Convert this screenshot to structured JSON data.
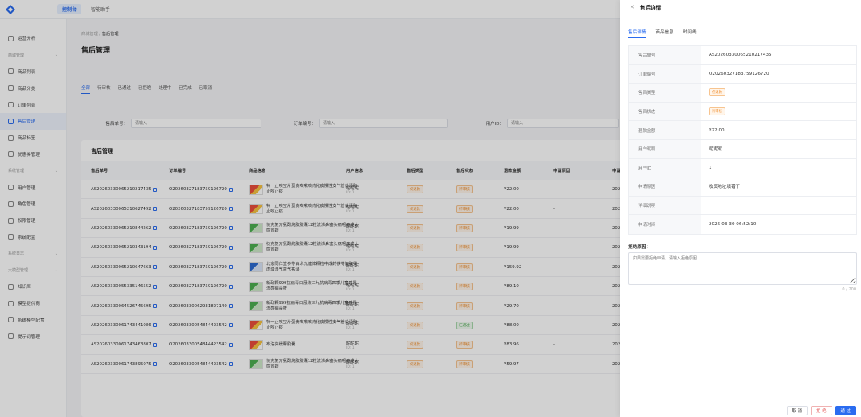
{
  "topbar": {
    "tabs": [
      "控制台",
      "智能助手"
    ]
  },
  "sidebar": {
    "items": [
      {
        "type": "item",
        "label": "运营分析",
        "icon": "clock-icon"
      },
      {
        "type": "group",
        "label": "商城管理"
      },
      {
        "type": "item",
        "label": "商品列表",
        "icon": "bag-icon"
      },
      {
        "type": "item",
        "label": "商品分类",
        "icon": "grid-icon"
      },
      {
        "type": "item",
        "label": "订单列表",
        "icon": "list-icon"
      },
      {
        "type": "item",
        "label": "售后管理",
        "icon": "aftersale-icon",
        "active": true
      },
      {
        "type": "item",
        "label": "商品标签",
        "icon": "tag-icon"
      },
      {
        "type": "item",
        "label": "优惠券管理",
        "icon": "coupon-icon"
      },
      {
        "type": "group",
        "label": "系统管理"
      },
      {
        "type": "item",
        "label": "用户管理",
        "icon": "user-icon"
      },
      {
        "type": "item",
        "label": "角色管理",
        "icon": "role-icon"
      },
      {
        "type": "item",
        "label": "权限管理",
        "icon": "key-icon"
      },
      {
        "type": "item",
        "label": "系统配置",
        "icon": "gear-icon"
      },
      {
        "type": "group",
        "label": "系统日志"
      },
      {
        "type": "group",
        "label": "大模型管理"
      },
      {
        "type": "item",
        "label": "知识库",
        "icon": "book-icon"
      },
      {
        "type": "item",
        "label": "模型提供商",
        "icon": "model-icon"
      },
      {
        "type": "item",
        "label": "系统模型配置",
        "icon": "config-icon"
      },
      {
        "type": "item",
        "label": "提示词管理",
        "icon": "bulb-icon"
      }
    ]
  },
  "main": {
    "breadcrumb_parent": "商城管理",
    "breadcrumb_sep": "/",
    "breadcrumb_current": "售后管理",
    "title": "售后管理",
    "tabs": [
      "全部",
      "待审核",
      "已通过",
      "已拒绝",
      "处理中",
      "已完成",
      "已取消"
    ],
    "filters": [
      {
        "label": "售后单号：",
        "placeholder": "请输入"
      },
      {
        "label": "订单编号：",
        "placeholder": "请输入"
      },
      {
        "label": "用户ID：",
        "placeholder": "请输入"
      }
    ],
    "table_title": "售后管理",
    "columns": [
      "售后单号",
      "订单编号",
      "商品信息",
      "用户信息",
      "售后类型",
      "售后状态",
      "退款金额",
      "申请原因",
      "申请"
    ],
    "rows": [
      {
        "no": "AS20260330065210217435",
        "order": "O20260327183759126720",
        "product": "特一止咳宝片蛋黄咳嗽咳药化痰慢性支气管炎清肺止咳止痰",
        "img": "r",
        "user": "昵昵昵",
        "uid": "ID: 1",
        "type": "仅退款",
        "status": "待审核",
        "amount": "¥22.00",
        "reason": "-",
        "date": "202"
      },
      {
        "no": "AS20260330065210627492",
        "order": "O20260327183759126720",
        "product": "特一止咳宝片蛋黄咳嗽咳药化痰慢性支气管炎清肺止咳止痰",
        "img": "r",
        "user": "昵昵昵",
        "uid": "ID: 1",
        "type": "仅退款",
        "status": "待审核",
        "amount": "¥22.00",
        "reason": "-",
        "date": "202"
      },
      {
        "no": "AS20260330065210844262",
        "order": "O20260327183759126720",
        "product": "快克复方氨酚烷胺胶囊12粒流涕鼻塞头痛咽痛成人感冒药",
        "img": "g",
        "user": "昵昵昵",
        "uid": "ID: 1",
        "type": "仅退款",
        "status": "待审核",
        "amount": "¥19.99",
        "reason": "-",
        "date": "202"
      },
      {
        "no": "AS20260330065210343194",
        "order": "O20260327183759126720",
        "product": "快克复方氨酚烷胺胶囊12粒流涕鼻塞头痛咽痛成人感冒药",
        "img": "g",
        "user": "昵昵昵",
        "uid": "ID: 1",
        "type": "仅退款",
        "status": "待审核",
        "amount": "¥19.99",
        "reason": "-",
        "date": "202"
      },
      {
        "no": "AS20260330065210647663",
        "order": "O20260327183759126720",
        "product": "北京同仁堂参苓白术丸健脾颗粒中成药茯苓健脾胃虚弱湿气益气祛湿",
        "img": "b",
        "user": "昵昵昵",
        "uid": "ID: 1",
        "type": "仅退款",
        "status": "待审核",
        "amount": "¥159.92",
        "reason": "-",
        "date": "202"
      },
      {
        "no": "AS20260330055335146552",
        "order": "O20260327183759126720",
        "product": "新政颗999抗病毒口服液三九抗病毒四季儿童感冒流感病毒杆",
        "img": "g",
        "user": "昵昵昵",
        "uid": "ID: 1",
        "type": "仅退款",
        "status": "待审核",
        "amount": "¥89.10",
        "reason": "-",
        "date": "202"
      },
      {
        "no": "AS20260330064526745695",
        "order": "O20260330062931827140",
        "product": "新政颗999抗病毒口服液三九抗病毒四季儿童感冒流感病毒杆",
        "img": "g",
        "user": "昵昵昵",
        "uid": "ID: 1",
        "type": "仅退款",
        "status": "待审核",
        "amount": "¥29.70",
        "reason": "-",
        "date": "202"
      },
      {
        "no": "AS20260330061743441086",
        "order": "O20260330054844423542",
        "product": "特一止咳宝片蛋黄咳嗽咳药化痰慢性支气管炎清肺止咳止痰",
        "img": "r",
        "user": "昵昵昵",
        "uid": "ID: 1",
        "type": "仅退款",
        "status": "已通过",
        "amount": "¥88.00",
        "reason": "-",
        "date": "202"
      },
      {
        "no": "AS20260330061743463807",
        "order": "O20260330054844423542",
        "product": "布洛芬缓释胶囊",
        "img": "r",
        "user": "昵昵昵",
        "uid": "ID: 1",
        "type": "仅退款",
        "status": "待审核",
        "amount": "¥83.96",
        "reason": "-",
        "date": "202"
      },
      {
        "no": "AS20260330061743895075",
        "order": "O20260330054844423542",
        "product": "快克复方氨酚烷胺胶囊12粒流涕鼻塞头痛咽痛成人感冒药",
        "img": "g",
        "user": "昵昵昵",
        "uid": "ID: 1",
        "type": "仅退款",
        "status": "待审核",
        "amount": "¥59.97",
        "reason": "-",
        "date": "202"
      }
    ]
  },
  "drawer": {
    "title": "售后详情",
    "tabs": [
      "售后详情",
      "商品信息",
      "时间线"
    ],
    "fields": [
      {
        "k": "售后单号",
        "v": "AS20260330065210217435"
      },
      {
        "k": "订单编号",
        "v": "O20260327183759126720"
      },
      {
        "k": "售后类型",
        "v": "仅退款",
        "tag": true
      },
      {
        "k": "售后状态",
        "v": "待审核",
        "tag": true
      },
      {
        "k": "退款金额",
        "v": "¥22.00"
      },
      {
        "k": "用户昵称",
        "v": "昵昵昵"
      },
      {
        "k": "用户ID",
        "v": "1"
      },
      {
        "k": "申请原因",
        "v": "收货地址填错了"
      },
      {
        "k": "详细说明",
        "v": "-"
      },
      {
        "k": "申请时间",
        "v": "2026-03-30 06:52:10"
      }
    ],
    "reject_label": "拒绝原因：",
    "reject_placeholder": "如果需要拒绝申请，请输入拒绝原因",
    "reject_count": "0 / 200",
    "btn_cancel": "取 消",
    "btn_reject": "拒 绝",
    "btn_approve": "通 过"
  },
  "colors": {
    "primary": "#2a6cf0",
    "warning": "#f08c2a",
    "success": "#44a54a",
    "danger": "#e45757"
  }
}
